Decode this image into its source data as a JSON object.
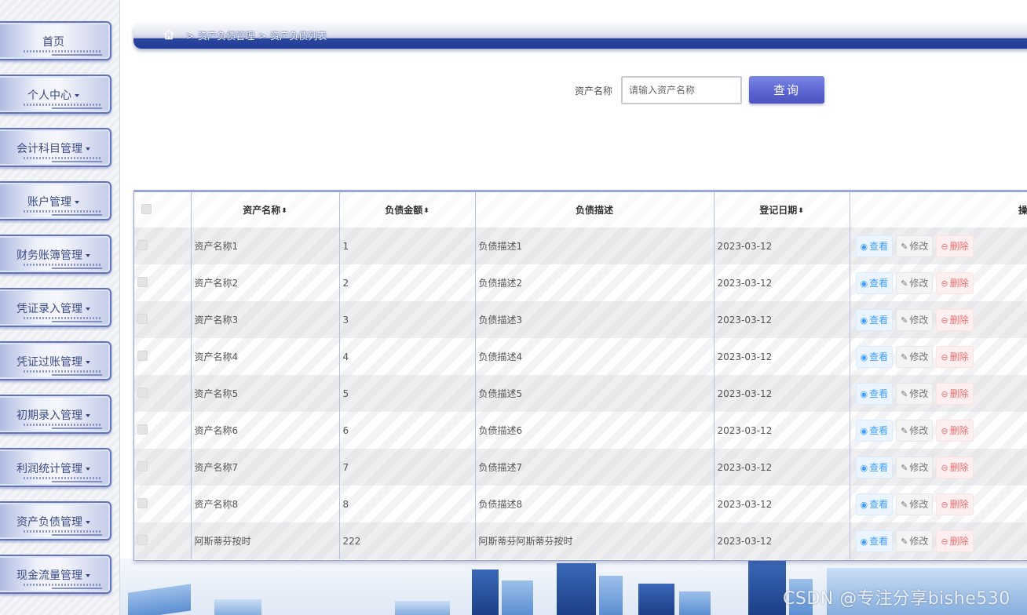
{
  "sidebar": {
    "items": [
      {
        "label": "首页",
        "has_caret": false
      },
      {
        "label": "个人中心",
        "has_caret": true
      },
      {
        "label": "会计科目管理",
        "has_caret": true
      },
      {
        "label": "账户管理",
        "has_caret": true
      },
      {
        "label": "财务账簿管理",
        "has_caret": true
      },
      {
        "label": "凭证录入管理",
        "has_caret": true
      },
      {
        "label": "凭证过账管理",
        "has_caret": true
      },
      {
        "label": "初期录入管理",
        "has_caret": true
      },
      {
        "label": "利润统计管理",
        "has_caret": true
      },
      {
        "label": "资产负债管理",
        "has_caret": true
      },
      {
        "label": "现金流量管理",
        "has_caret": true
      }
    ]
  },
  "breadcrumb": {
    "separator": ">",
    "items": [
      "资产负债管理",
      "资产负债列表"
    ]
  },
  "search": {
    "label": "资产名称",
    "placeholder": "请输入资产名称",
    "button_label": "查询"
  },
  "table": {
    "columns": [
      {
        "label": "资产名称",
        "sortable": true
      },
      {
        "label": "负债金额",
        "sortable": true
      },
      {
        "label": "负债描述",
        "sortable": false
      },
      {
        "label": "登记日期",
        "sortable": true
      },
      {
        "label": "操作",
        "sortable": false
      }
    ],
    "sort_icon": "◆",
    "actions": {
      "view": "查看",
      "edit": "修改",
      "delete": "删除"
    },
    "rows": [
      {
        "name": "资产名称1",
        "amount": "1",
        "desc": "负债描述1",
        "date": "2023-03-12"
      },
      {
        "name": "资产名称2",
        "amount": "2",
        "desc": "负债描述2",
        "date": "2023-03-12"
      },
      {
        "name": "资产名称3",
        "amount": "3",
        "desc": "负债描述3",
        "date": "2023-03-12"
      },
      {
        "name": "资产名称4",
        "amount": "4",
        "desc": "负债描述4",
        "date": "2023-03-12"
      },
      {
        "name": "资产名称5",
        "amount": "5",
        "desc": "负债描述5",
        "date": "2023-03-12"
      },
      {
        "name": "资产名称6",
        "amount": "6",
        "desc": "负债描述6",
        "date": "2023-03-12"
      },
      {
        "name": "资产名称7",
        "amount": "7",
        "desc": "负债描述7",
        "date": "2023-03-12"
      },
      {
        "name": "资产名称8",
        "amount": "8",
        "desc": "负债描述8",
        "date": "2023-03-12"
      },
      {
        "name": "阿斯蒂芬按时",
        "amount": "222",
        "desc": "阿斯蒂芬阿斯蒂芬按时",
        "date": "2023-03-12"
      }
    ]
  },
  "watermark": "CSDN @专注分享bishe530",
  "colors": {
    "accent": "#1f3b93",
    "search_button": "#5a63cf",
    "view": "#409eff",
    "delete": "#f56c6c"
  }
}
